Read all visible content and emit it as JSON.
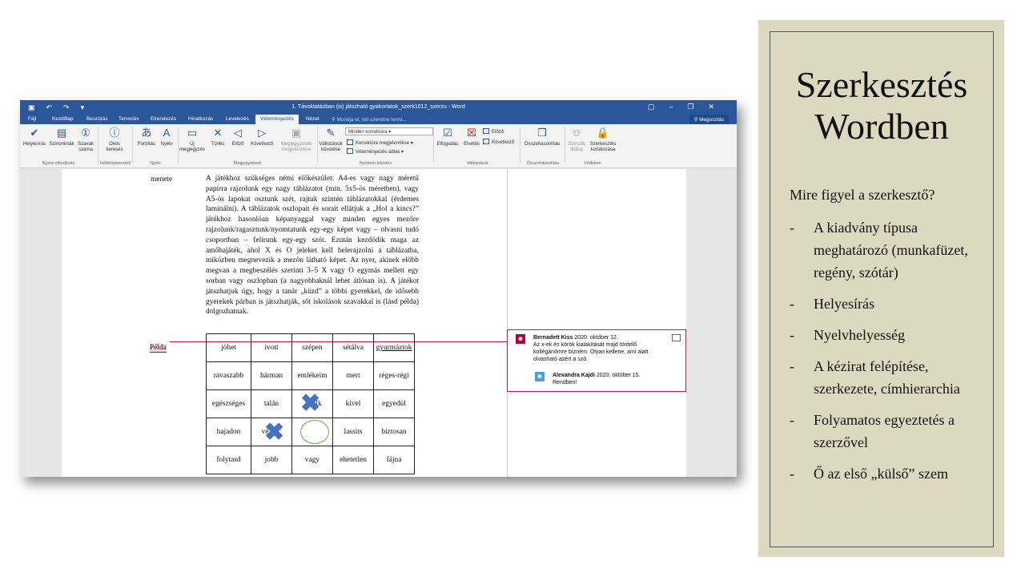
{
  "word": {
    "window_title": "1. Távoktatásban (is) játszható gyakorlatok_szerk1012_szerzu - Word",
    "tabs": [
      "Fájl",
      "Kezdőlap",
      "Beszúrás",
      "Tervezés",
      "Elrendezés",
      "Hivatkozás",
      "Levelezés",
      "Véleményezés",
      "Nézet"
    ],
    "active_tab": "Véleményezés",
    "tell_me": "Mondja el, mit szeretne tenni...",
    "share": "Megosztás",
    "ribbon": {
      "helyesiras": "Helyesírás",
      "szinonimak": "Szinonimák",
      "szavak": "Szavak száma",
      "okos": "Okos keresés",
      "forditas": "Fordítás",
      "nyelv": "Nyelv",
      "uj_megj": "Új megjegyzés",
      "torles": "Törlés",
      "elozo": "Előző",
      "kovetkezo": "Következő",
      "megj_megj": "Megjegyzések megjelenítése",
      "valtozasok": "Változások követése",
      "minden_korr": "Minden korrektúra",
      "korr_megj": "Korrektúra megjelenítése",
      "vel_ablak": "Véleményezés ablak",
      "elfogadas": "Elfogadás",
      "elvetes": "Elvetés",
      "elozo2": "Előző",
      "kovetkezo2": "Következő",
      "osszehas": "Összehasonlítás",
      "szerzok": "Szerzők tiltása",
      "szerk_korl": "Szerkesztés korlátozása",
      "g_nyelvi": "Nyelvi ellenőrzés",
      "g_hatter": "Háttérismeretek",
      "g_nyelv": "Nyelv",
      "g_megj": "Megjegyzések",
      "g_nyomon": "Nyomon követés",
      "g_valt": "Változások",
      "g_ossz": "Összehasonlítás",
      "g_vedelem": "Védelem"
    },
    "doc": {
      "label_menete": "menete",
      "paragraph": "A játékhoz szükséges némi előkészület: A4-es vagy nagy méretű papírra rajzolunk egy nagy táblázatot (min. 5x5-ös méretben), vagy A5-ös lapokat osztunk szét, rajtuk szintén táblázatokkal (érdemes laminálni). A táblázatok oszlopait és sorait ellátjuk a „Hol a kincs?” játékhoz hasonlóan képanyaggal vagy minden egyes mezőre rajzolunk/ragasztunk/nyomtatunk egy-egy képet vagy – olvasni tudó csoportban – felírunk egy-egy szót. Ezután kezdődik maga az amőbajáték, ahol X és O jeleket kell belerajzolni a táblázatba, miközben megnevezik a mezőn látható képet. Az nyer, akinek előbb megvan a megbeszélés szerinti 3–5 X vagy O egymás mellett egy sorban vagy oszlopban (a nagyobbaknál lehet átlósan is). A játékot játszhatjuk úgy, hogy a tanár „küzd” a többi gyerekkel, de idősebb gyerekek párban is játszhatják, sőt iskolások szavakkal is (lásd példa) dolgozhatnak.",
      "label_pelda": "Példa",
      "table": [
        [
          "jöhet",
          "ivott",
          "szépen",
          "sétálva",
          "gyurmáztok"
        ],
        [
          "ravaszabb",
          "hárman",
          "emlékeim",
          "mert",
          "réges-régi"
        ],
        [
          "egészséges",
          "talán",
          "lk",
          "kivel",
          "egyedül"
        ],
        [
          "hajadon",
          "vé",
          "",
          "lassits",
          "biztosan"
        ],
        [
          "folytasd",
          "jobb",
          "vagy",
          "ehetetlen",
          "fájna"
        ]
      ]
    },
    "comment": {
      "author1": "Bernadett Kiss",
      "date1": "2020. október 12.",
      "text1": "Az x-ek és körök kialakítását majd tördelő kollégánőmre bízném. Olyan kellene, ami alatt olvasható azért a szó.",
      "author2": "Alexandra Kajdi",
      "date2": "2020. október 15.",
      "text2": "Rendben!"
    }
  },
  "panel": {
    "title_line1": "Szerkesztés",
    "title_line2": "Wordben",
    "lead": "Mire figyel a szerkesztő?",
    "items": [
      "A kiadvány típusa meghatározó (munkafüzet, regény, szótár)",
      "Helyesírás",
      "Nyelvhelyesség",
      "A kézirat felépítése, szerkezete, címhierarchia",
      "Folyamatos egyeztetés a szerzővel",
      "Ő az első „külső” szem"
    ],
    "dash": "-"
  }
}
